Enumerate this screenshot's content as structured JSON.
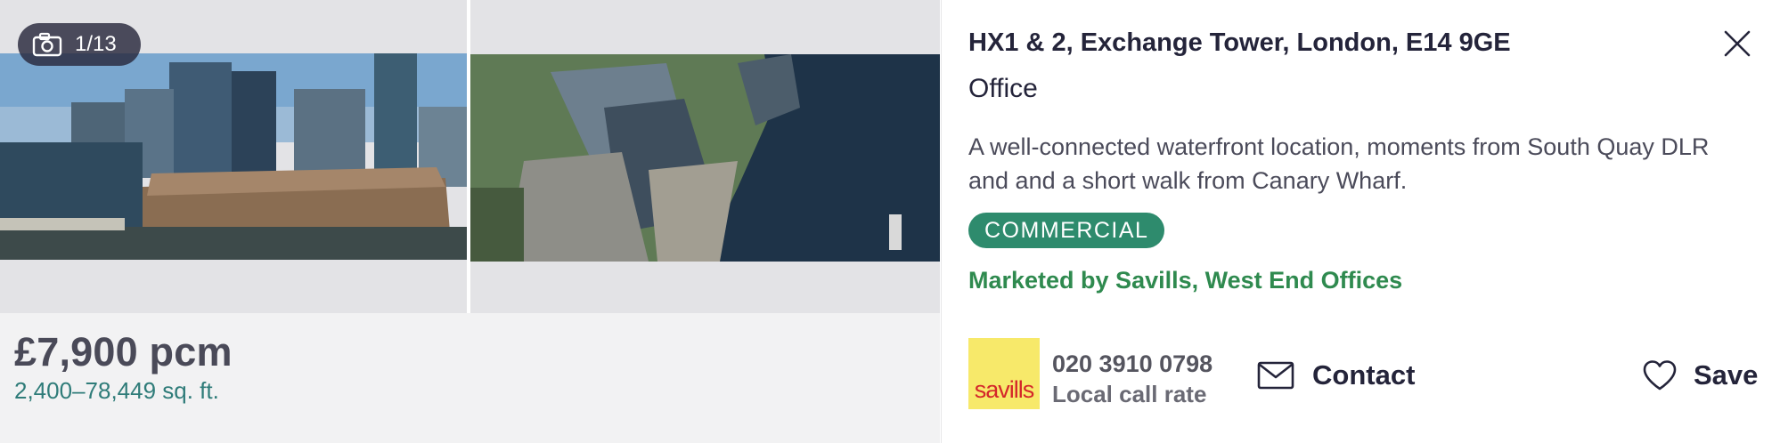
{
  "gallery": {
    "counter": "1/13",
    "camera_icon": "camera-icon"
  },
  "listing": {
    "price": "£7,900 pcm",
    "area": "2,400–78,449 sq. ft.",
    "title": "HX1 & 2, Exchange Tower, London, E14 9GE",
    "type": "Office",
    "description": "A well-connected waterfront location, moments from South Quay DLR and and a short walk from Canary Wharf.",
    "tag": "COMMERCIAL",
    "marketed_by": "Marketed by Savills, West End Offices"
  },
  "agent": {
    "logo_text": "savills",
    "phone": "020 3910 0798",
    "rate": "Local call rate"
  },
  "actions": {
    "contact_label": "Contact",
    "save_label": "Save"
  },
  "colors": {
    "tag_bg": "#2e8b6d",
    "agent_link": "#2f8a4f",
    "area_text": "#2f7c79",
    "logo_bg": "#f7e96a",
    "logo_text": "#d4262a"
  }
}
